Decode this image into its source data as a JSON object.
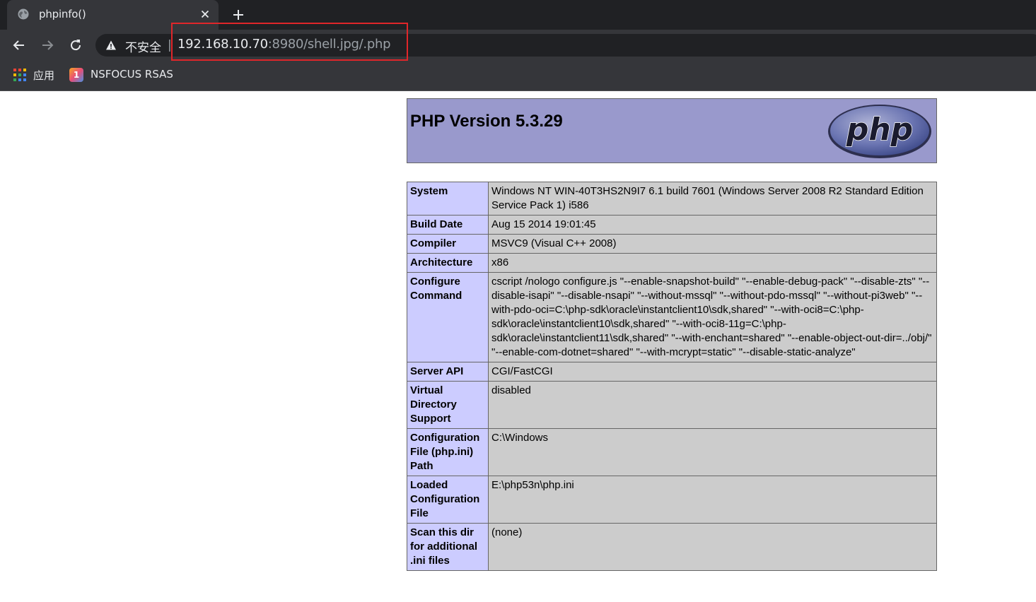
{
  "browser": {
    "tab_title": "phpinfo()",
    "new_tab_label": "+",
    "insecure_label": "不安全",
    "separator": "|",
    "url_host": "192.168.10.70",
    "url_rest": ":8980/shell.jpg/.php",
    "highlight_color": "#e0262a",
    "bookmarks": [
      {
        "label": "应用",
        "icon": "apps-grid-icon"
      },
      {
        "label": "NSFOCUS RSAS",
        "icon": "nsfocus-icon",
        "icon_text": "1"
      }
    ]
  },
  "phpinfo": {
    "version_title": "PHP Version 5.3.29",
    "logo_text": "php",
    "header_color": "#9999cc",
    "rows": [
      {
        "key": "System",
        "value": "Windows NT WIN-40T3HS2N9I7 6.1 build 7601 (Windows Server 2008 R2 Standard Edition Service Pack 1) i586"
      },
      {
        "key": "Build Date",
        "value": "Aug 15 2014 19:01:45"
      },
      {
        "key": "Compiler",
        "value": "MSVC9 (Visual C++ 2008)"
      },
      {
        "key": "Architecture",
        "value": "x86"
      },
      {
        "key": "Configure Command",
        "value": "cscript /nologo configure.js \"--enable-snapshot-build\" \"--enable-debug-pack\" \"--disable-zts\" \"--disable-isapi\" \"--disable-nsapi\" \"--without-mssql\" \"--without-pdo-mssql\" \"--without-pi3web\" \"--with-pdo-oci=C:\\php-sdk\\oracle\\instantclient10\\sdk,shared\" \"--with-oci8=C:\\php-sdk\\oracle\\instantclient10\\sdk,shared\" \"--with-oci8-11g=C:\\php-sdk\\oracle\\instantclient11\\sdk,shared\" \"--with-enchant=shared\" \"--enable-object-out-dir=../obj/\" \"--enable-com-dotnet=shared\" \"--with-mcrypt=static\" \"--disable-static-analyze\""
      },
      {
        "key": "Server API",
        "value": "CGI/FastCGI"
      },
      {
        "key": "Virtual Directory Support",
        "value": "disabled"
      },
      {
        "key": "Configuration File (php.ini) Path",
        "value": "C:\\Windows"
      },
      {
        "key": "Loaded Configuration File",
        "value": "E:\\php53n\\php.ini"
      },
      {
        "key": "Scan this dir for additional .ini files",
        "value": "(none)"
      }
    ]
  }
}
